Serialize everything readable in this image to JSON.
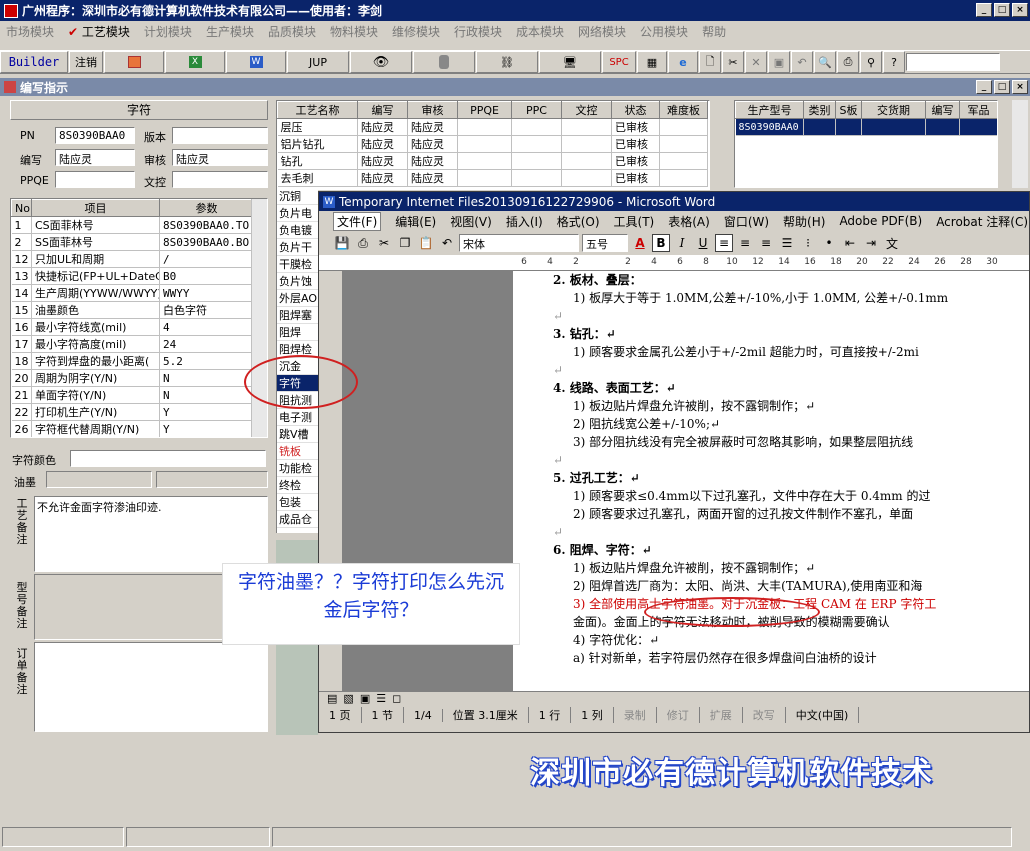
{
  "app": {
    "title": "广州程序：深圳市必有德计算机软件技术有限公司——使用者：李剑",
    "window_buttons": [
      "_",
      "□",
      "×"
    ]
  },
  "menu": [
    "市场模块",
    "工艺模块",
    "计划模块",
    "生产模块",
    "品质模块",
    "物料模块",
    "维修模块",
    "行政模块",
    "成本模块",
    "网络模块",
    "公用模块",
    "帮助"
  ],
  "toolbar": {
    "builder": "Builder",
    "cancel": "注销",
    "jup": "JUP",
    "spc": "SPC"
  },
  "child_window": {
    "title": "编写指示",
    "buttons": [
      "_",
      "□",
      "×"
    ]
  },
  "left_panel": {
    "header": "字符",
    "pn_label": "PN",
    "pn_value": "8S0390BAA0",
    "version_label": "版本",
    "version_value": "",
    "writer_label": "编写",
    "writer_value": "陆应灵",
    "review_label": "审核",
    "review_value": "陆应灵",
    "ppqe_label": "PPQE",
    "ppqe_value": "",
    "doc_label": "文控",
    "doc_value": "",
    "params_headers": [
      "No",
      "项目",
      "参数"
    ],
    "params": [
      [
        "1",
        "CS面菲林号",
        "8S0390BAA0.TO"
      ],
      [
        "2",
        "SS面菲林号",
        "8S0390BAA0.BO"
      ],
      [
        "12",
        "只加UL和周期",
        "/"
      ],
      [
        "13",
        "快捷标记(FP+UL+DateCo",
        "B0"
      ],
      [
        "14",
        "生产周期(YYWW/WWYY)",
        "WWYY"
      ],
      [
        "15",
        "油墨颜色",
        "白色字符"
      ],
      [
        "16",
        "最小字符线宽(mil)",
        "4"
      ],
      [
        "17",
        "最小字符高度(mil)",
        "24"
      ],
      [
        "18",
        "字符到焊盘的最小距离(",
        "5.2"
      ],
      [
        "20",
        "周期为阴字(Y/N)",
        "N"
      ],
      [
        "21",
        "单面字符(Y/N)",
        "N"
      ],
      [
        "22",
        "打印机生产(Y/N)",
        "Y"
      ],
      [
        "26",
        "字符框代替周期(Y/N)",
        "Y"
      ]
    ],
    "char_color_label": "字符颜色",
    "ink_label": "油墨",
    "process_note_label": "工艺备注",
    "process_note_value": "不允许金面字符渗油印迹.",
    "model_note_label": "型号备注",
    "order_note_label": "订单备注"
  },
  "process_table": {
    "headers": [
      "工艺名称",
      "编写",
      "审核",
      "PPQE",
      "PPC",
      "文控",
      "状态",
      "难度板"
    ],
    "rows": [
      [
        "层压",
        "陆应灵",
        "陆应灵",
        "",
        "",
        "",
        "已审核",
        ""
      ],
      [
        "铝片钻孔",
        "陆应灵",
        "陆应灵",
        "",
        "",
        "",
        "已审核",
        ""
      ],
      [
        "钻孔",
        "陆应灵",
        "陆应灵",
        "",
        "",
        "",
        "已审核",
        ""
      ],
      [
        "去毛刺",
        "陆应灵",
        "陆应灵",
        "",
        "",
        "",
        "已审核",
        ""
      ]
    ],
    "more_rows": [
      "沉铜",
      "负片电",
      "负电镀",
      "负片干",
      "干膜检",
      "负片蚀",
      "外层AO",
      "阻焊塞",
      "阻焊",
      "阻焊检",
      "沉金",
      "字符",
      "阻抗测",
      "电子测",
      "跳V槽",
      "铣板",
      "功能检",
      "终检",
      "包装",
      "成品仓"
    ]
  },
  "right_table": {
    "headers": [
      "生产型号",
      "类别",
      "S板",
      "交货期",
      "编写",
      "军品"
    ],
    "rows": [
      [
        "8S0390BAA0",
        "",
        "",
        "",
        "",
        ""
      ]
    ]
  },
  "word": {
    "title": "Temporary Internet Files20130916122729906 - Microsoft Word",
    "menu": [
      "文件(F)",
      "编辑(E)",
      "视图(V)",
      "插入(I)",
      "格式(O)",
      "工具(T)",
      "表格(A)",
      "窗口(W)",
      "帮助(H)",
      "Adobe PDF(B)",
      "Acrobat 注释(C)"
    ],
    "font": "宋体",
    "size": "五号",
    "ruler_ticks": [
      "6",
      "4",
      "2",
      "",
      "2",
      "4",
      "6",
      "8",
      "10",
      "12",
      "14",
      "16",
      "18",
      "20",
      "22",
      "24",
      "26",
      "28",
      "30"
    ],
    "doc_lines": [
      {
        "kind": "h",
        "text": "2.  板材、叠层："
      },
      {
        "kind": "p",
        "text": "1) 板厚大于等于 1.0MM,公差+/-10%,小于 1.0MM, 公差+/-0.1mm"
      },
      {
        "kind": "b",
        "text": "↵"
      },
      {
        "kind": "h",
        "text": "3.  钻孔：↵"
      },
      {
        "kind": "p",
        "text": "1) 顾客要求金属孔公差小于+/-2mil 超能力时，可直接按+/-2mi"
      },
      {
        "kind": "b",
        "text": "↵"
      },
      {
        "kind": "h",
        "text": "4.  线路、表面工艺：↵"
      },
      {
        "kind": "p",
        "text": "1) 板边贴片焊盘允许被削，按不露铜制作；↵"
      },
      {
        "kind": "p",
        "text": "2) 阻抗线宽公差+/-10%;↵"
      },
      {
        "kind": "p",
        "text": "3) 部分阻抗线没有完全被屏蔽时可忽略其影响，如果整层阻抗线"
      },
      {
        "kind": "b",
        "text": "↵"
      },
      {
        "kind": "h",
        "text": "5.  过孔工艺：↵"
      },
      {
        "kind": "p",
        "text": "1) 顾客要求≤0.4mm以下过孔塞孔，文件中存在大于 0.4mm 的过"
      },
      {
        "kind": "p",
        "text": "2) 顾客要求过孔塞孔，两面开窗的过孔按文件制作不塞孔，单面"
      },
      {
        "kind": "b",
        "text": "↵"
      },
      {
        "kind": "h",
        "text": "6.  阻焊、字符：↵"
      },
      {
        "kind": "p",
        "text": "1) 板边贴片焊盘允许被削，按不露铜制作；↵"
      },
      {
        "kind": "p",
        "text": "2) 阻焊首选厂商为：太阳、尚洪、大丰(TAMURA),使用南亚和海"
      },
      {
        "kind": "r",
        "text": "3) 全部使用高士字符油墨。对于沉金板：工程 CAM 在 ERP 字符工"
      },
      {
        "kind": "p",
        "text": "   金面)。金面上的字符无法移动时，被削导致的模糊需要确认"
      },
      {
        "kind": "p",
        "text": "4) 字符优化：↵"
      },
      {
        "kind": "p",
        "text": "    a) 针对新单，若字符层仍然存在很多焊盘间白油桥的设计"
      }
    ],
    "status": [
      "1 页",
      "1 节",
      "1/4",
      "位置 3.1厘米",
      "1 行",
      "1 列",
      "录制",
      "修订",
      "扩展",
      "改写",
      "中文(中国)"
    ]
  },
  "callout": {
    "line1": "字符油墨？？字符打印怎么先沉",
    "line2": "金后字符？"
  },
  "banner": "深圳市必有德计算机软件技术",
  "colors": {
    "titlebar": "#0a246a",
    "highlight": "#0a246a",
    "annotation": "#d02020",
    "callout_text": "#1a3bd6"
  }
}
